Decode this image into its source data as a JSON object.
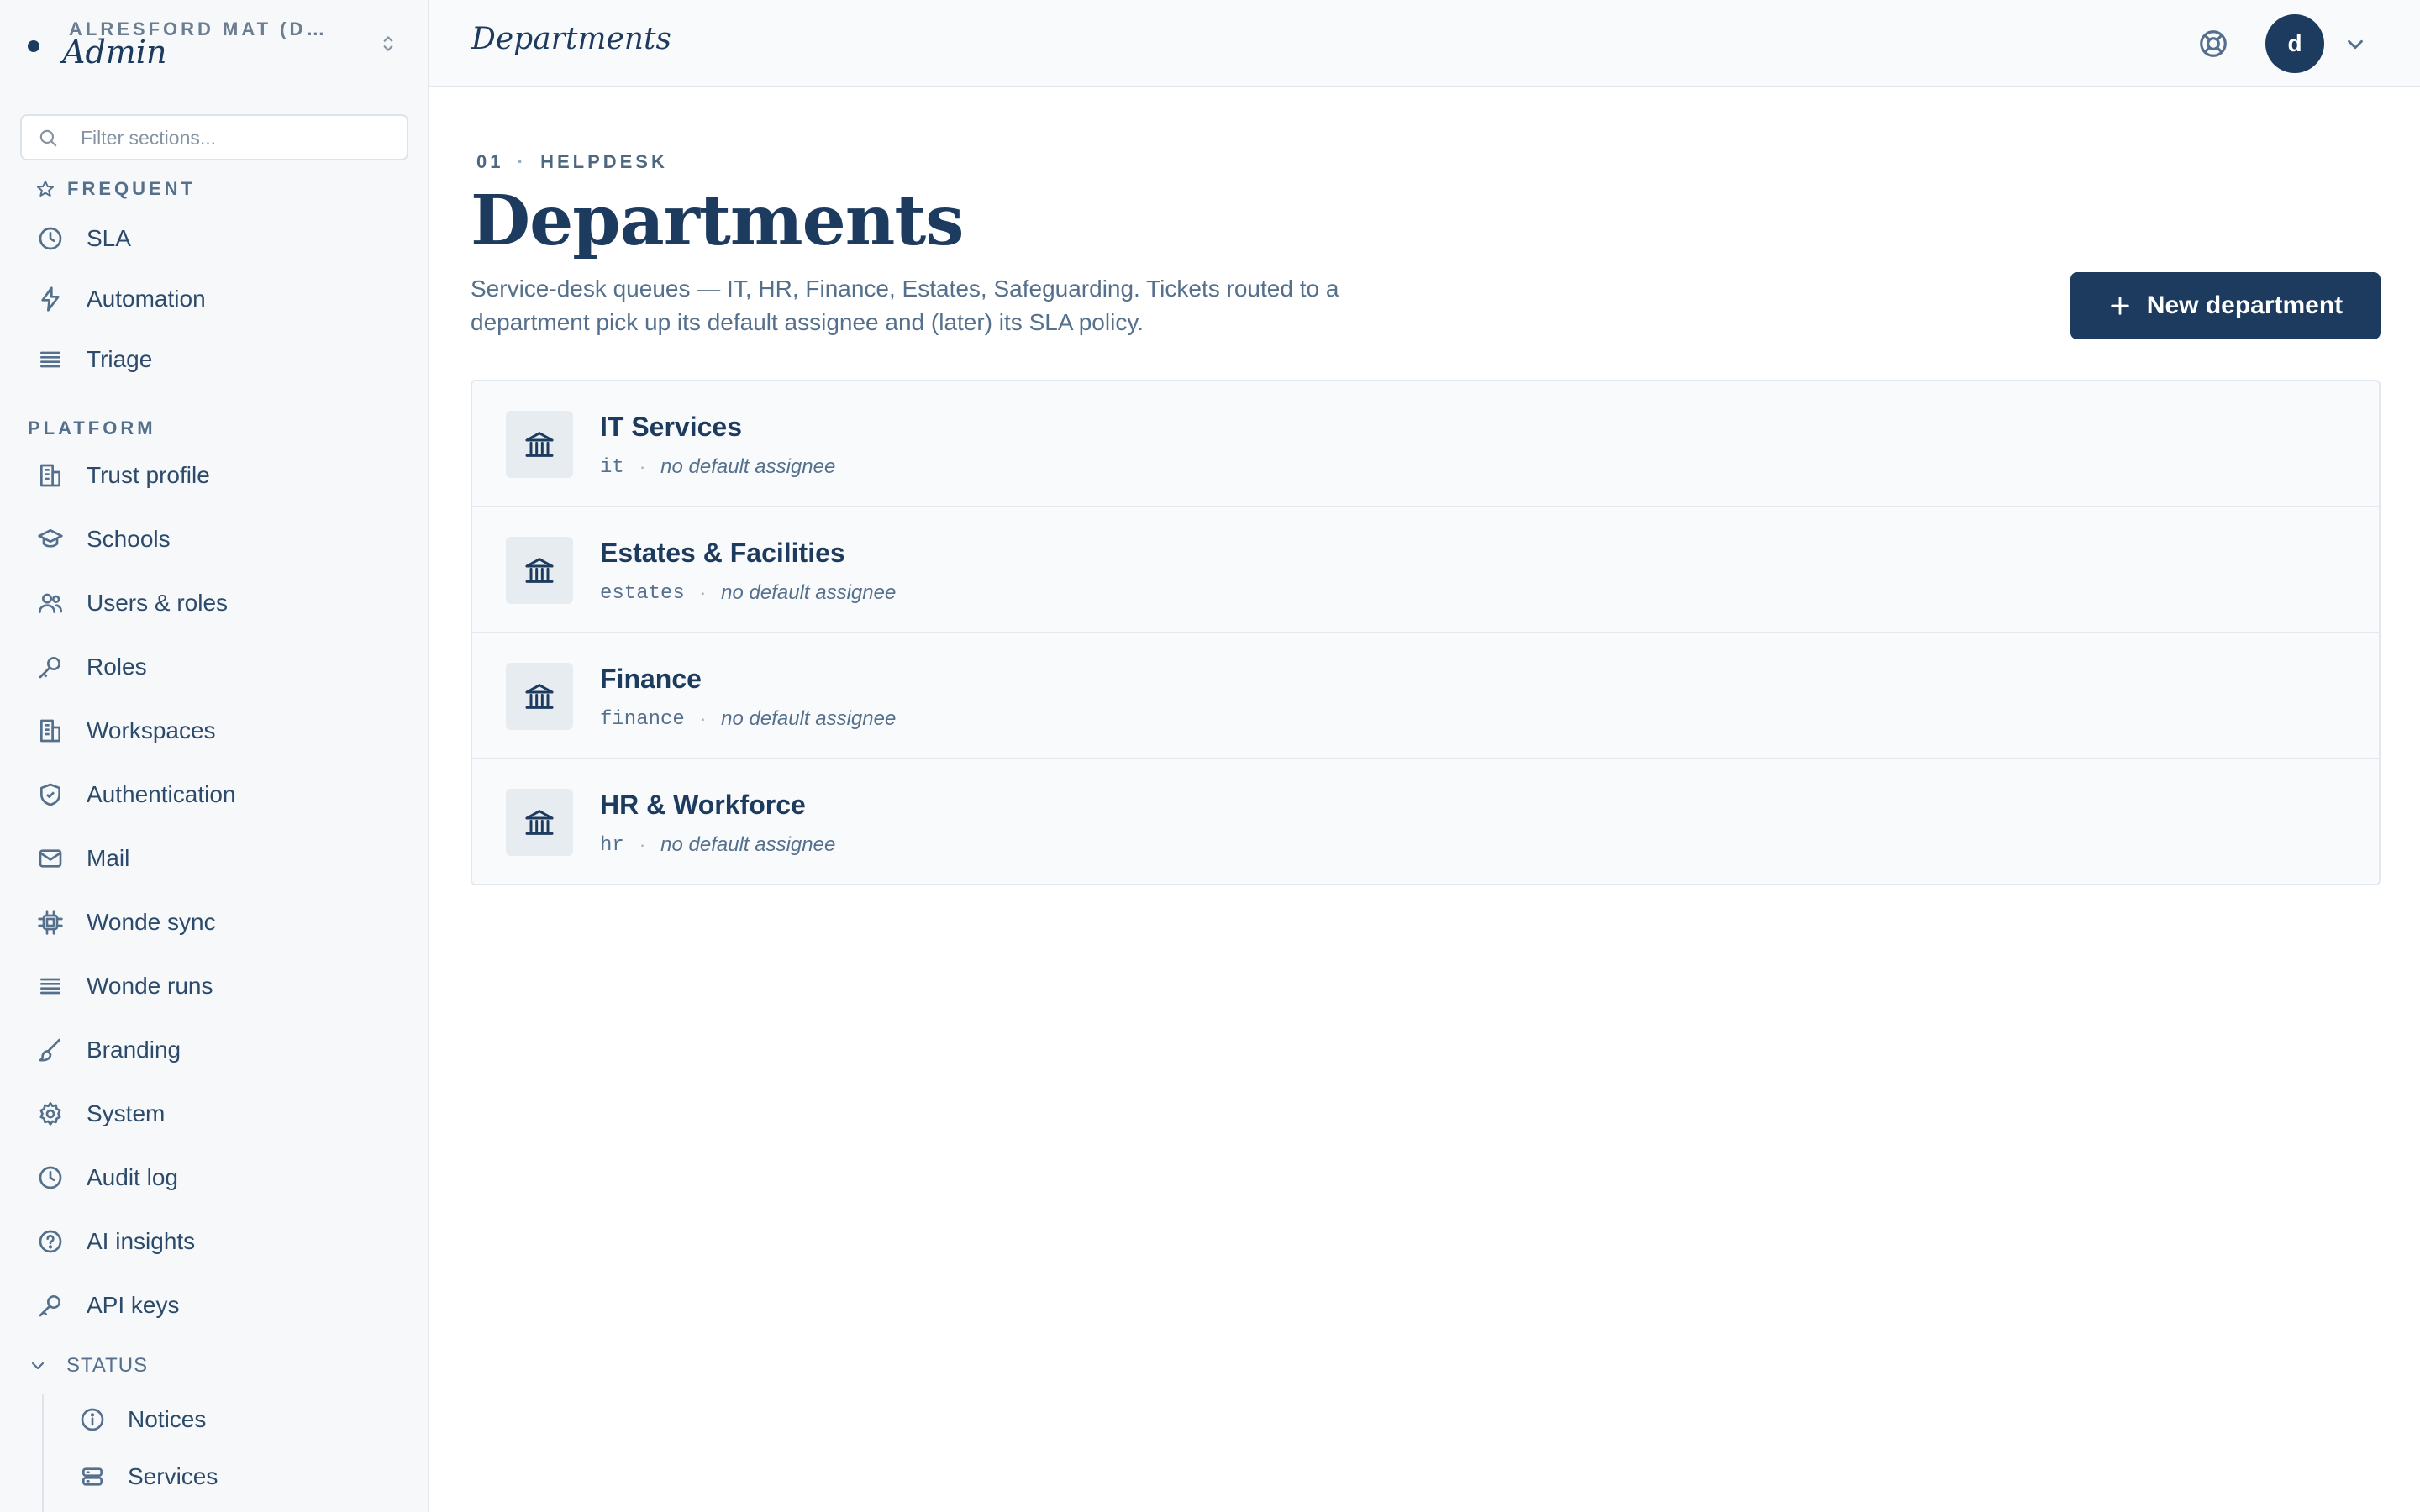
{
  "org": {
    "name": "ALRESFORD MAT (DEMO)",
    "app": "Admin"
  },
  "filter": {
    "placeholder": "Filter sections..."
  },
  "sidebar": {
    "frequent_label": "FREQUENT",
    "frequent": [
      {
        "label": "SLA",
        "icon": "clock-icon"
      },
      {
        "label": "Automation",
        "icon": "bolt-icon"
      },
      {
        "label": "Triage",
        "icon": "list-icon"
      }
    ],
    "platform_label": "PLATFORM",
    "platform": [
      {
        "label": "Trust profile",
        "icon": "building-icon"
      },
      {
        "label": "Schools",
        "icon": "graduation-cap-icon"
      },
      {
        "label": "Users & roles",
        "icon": "users-icon"
      },
      {
        "label": "Roles",
        "icon": "key-icon"
      },
      {
        "label": "Workspaces",
        "icon": "building-icon"
      },
      {
        "label": "Authentication",
        "icon": "shield-icon"
      },
      {
        "label": "Mail",
        "icon": "mail-icon"
      },
      {
        "label": "Wonde sync",
        "icon": "chip-icon"
      },
      {
        "label": "Wonde runs",
        "icon": "list-icon"
      },
      {
        "label": "Branding",
        "icon": "brush-icon"
      },
      {
        "label": "System",
        "icon": "gear-icon"
      },
      {
        "label": "Audit log",
        "icon": "clock-icon"
      },
      {
        "label": "AI insights",
        "icon": "question-icon"
      },
      {
        "label": "API keys",
        "icon": "key-icon"
      }
    ],
    "status_label": "STATUS",
    "status": [
      {
        "label": "Notices",
        "icon": "info-icon"
      },
      {
        "label": "Services",
        "icon": "server-icon"
      }
    ]
  },
  "topbar": {
    "title": "Departments",
    "avatar_initial": "d"
  },
  "page": {
    "eyebrow_number": "01",
    "eyebrow_section": "HELPDESK",
    "heading": "Departments",
    "description": "Service-desk queues — IT, HR, Finance, Estates, Safeguarding. Tickets routed to a department pick up its default assignee and (later) its SLA policy.",
    "new_button": "New department"
  },
  "departments": [
    {
      "name": "IT Services",
      "slug": "it",
      "assignee": "no default assignee"
    },
    {
      "name": "Estates & Facilities",
      "slug": "estates",
      "assignee": "no default assignee"
    },
    {
      "name": "Finance",
      "slug": "finance",
      "assignee": "no default assignee"
    },
    {
      "name": "HR & Workforce",
      "slug": "hr",
      "assignee": "no default assignee"
    }
  ],
  "colors": {
    "primary": "#1d3b5e",
    "text_muted": "#55708c",
    "border": "#e3e8ee",
    "sidebar_bg": "#f6f8fa"
  }
}
